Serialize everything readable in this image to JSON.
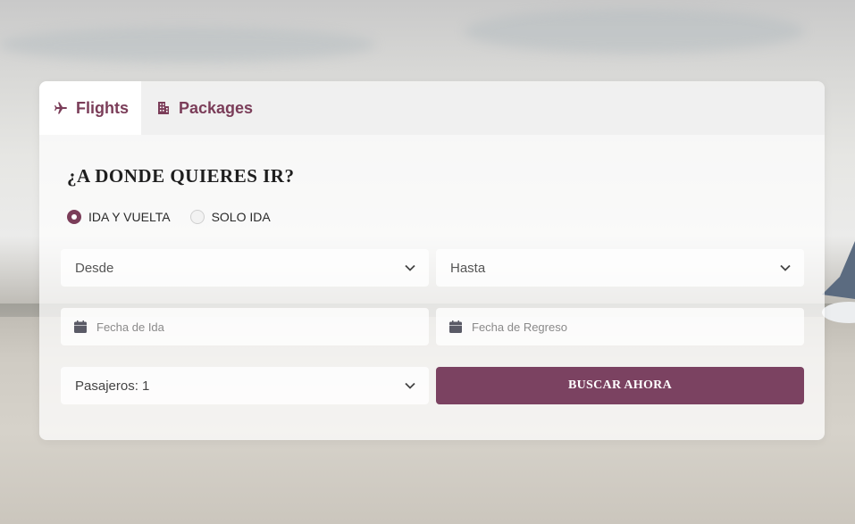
{
  "tabs": [
    {
      "label": "Flights",
      "icon": "airplane-icon",
      "active": true
    },
    {
      "label": "Packages",
      "icon": "building-icon",
      "active": false
    }
  ],
  "form": {
    "title": "¿A DONDE QUIERES IR?",
    "trip_types": [
      {
        "label": "IDA Y VUELTA",
        "selected": true
      },
      {
        "label": "SOLO IDA",
        "selected": false
      }
    ],
    "from": {
      "value": "Desde"
    },
    "to": {
      "value": "Hasta"
    },
    "departure_date": {
      "placeholder": "Fecha de Ida"
    },
    "return_date": {
      "placeholder": "Fecha de Regreso"
    },
    "passengers": {
      "value": "Pasajeros: 1"
    },
    "search_button": "BUSCAR AHORA"
  },
  "colors": {
    "accent": "#7b3d59",
    "button": "#7b4261"
  }
}
